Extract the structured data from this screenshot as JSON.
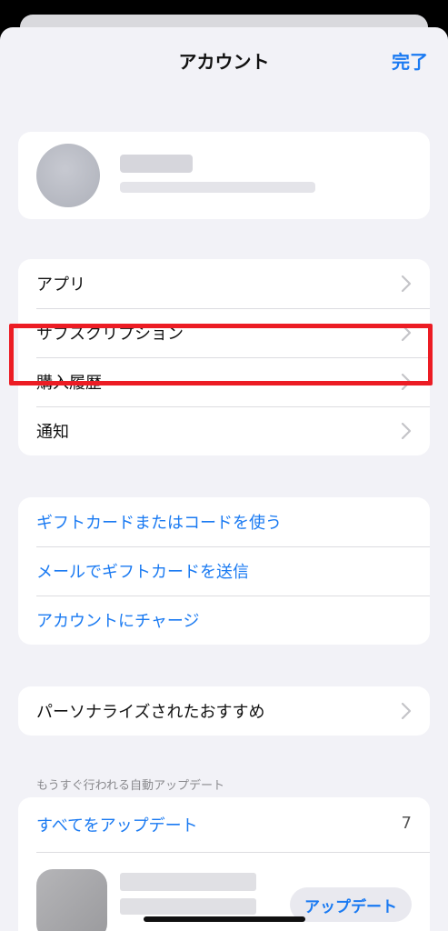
{
  "header": {
    "title": "アカウント",
    "done_label": "完了"
  },
  "menu_main": [
    {
      "label": "アプリ"
    },
    {
      "label": "サブスクリプション"
    },
    {
      "label": "購入履歴"
    },
    {
      "label": "通知"
    }
  ],
  "menu_gift": [
    {
      "label": "ギフトカードまたはコードを使う"
    },
    {
      "label": "メールでギフトカードを送信"
    },
    {
      "label": "アカウントにチャージ"
    }
  ],
  "menu_personal": {
    "label": "パーソナライズされたおすすめ"
  },
  "updates": {
    "section_title": "もうすぐ行われる自動アップデート",
    "update_all_label": "すべてをアップデート",
    "count": "7",
    "update_button_label": "アップデート"
  },
  "colors": {
    "accent": "#1a7af2",
    "highlight": "#ec1c24",
    "background": "#f2f2f7"
  },
  "icons": {
    "chevron": "chevron-right-icon"
  }
}
